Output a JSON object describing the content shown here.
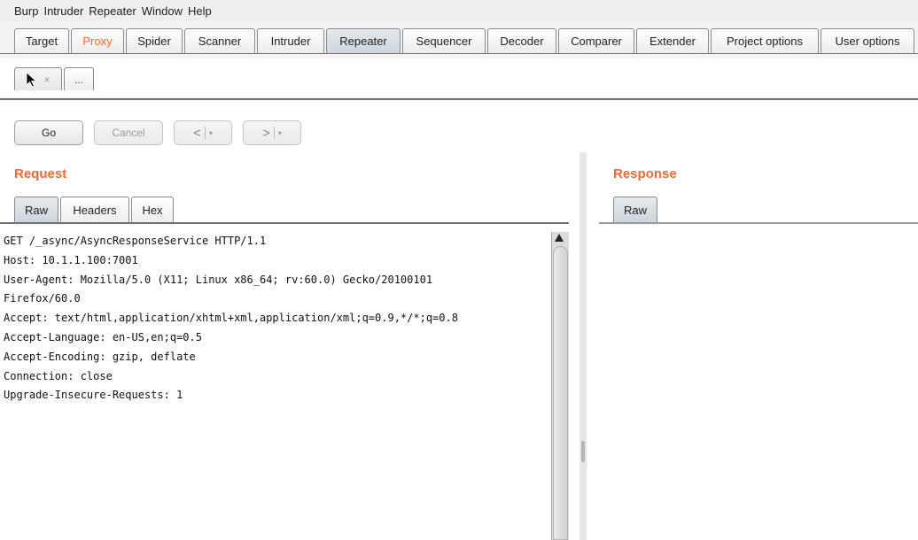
{
  "menubar": {
    "items": [
      "Burp",
      "Intruder",
      "Repeater",
      "Window",
      "Help"
    ]
  },
  "main_tabs": {
    "items": [
      "Target",
      "Proxy",
      "Spider",
      "Scanner",
      "Intruder",
      "Repeater",
      "Sequencer",
      "Decoder",
      "Comparer",
      "Extender",
      "Project options",
      "User options"
    ],
    "active": "Repeater",
    "highlighted": "Proxy"
  },
  "sub_tabs": {
    "close_glyph": "×",
    "more_label": "..."
  },
  "toolbar": {
    "go_label": "Go",
    "cancel_label": "Cancel",
    "back_label": "<",
    "forward_label": ">",
    "dropdown_glyph": "▾"
  },
  "request": {
    "title": "Request",
    "tabs": [
      "Raw",
      "Headers",
      "Hex"
    ],
    "active_tab": "Raw",
    "lines": [
      "GET /_async/AsyncResponseService HTTP/1.1",
      "Host: 10.1.1.100:7001",
      "User-Agent: Mozilla/5.0 (X11; Linux x86_64; rv:60.0) Gecko/20100101",
      "Firefox/60.0",
      "Accept: text/html,application/xhtml+xml,application/xml;q=0.9,*/*;q=0.8",
      "Accept-Language: en-US,en;q=0.5",
      "Accept-Encoding: gzip, deflate",
      "Connection: close",
      "Upgrade-Insecure-Requests: 1"
    ]
  },
  "response": {
    "title": "Response",
    "tabs": [
      "Raw"
    ],
    "active_tab": "Raw"
  },
  "colors": {
    "accent": "#f06a32",
    "active_tab": "#d6dde2"
  },
  "icons": {
    "cursor": "mouse-pointer-icon",
    "scroll_up": "scroll-up-arrow-icon"
  }
}
